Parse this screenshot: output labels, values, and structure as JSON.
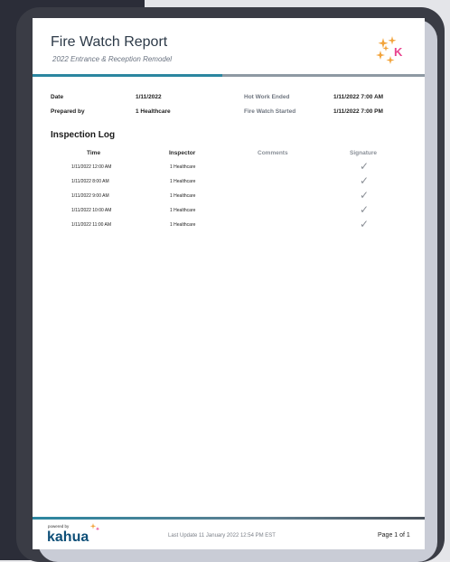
{
  "report": {
    "title": "Fire Watch Report",
    "subtitle": "2022 Entrance & Reception Remodel"
  },
  "info": {
    "date_label": "Date",
    "date_value": "1/11/2022",
    "prepared_label": "Prepared by",
    "prepared_value": "1 Healthcare",
    "hot_work_label": "Hot Work Ended",
    "hot_work_value": "1/11/2022 7:00 AM",
    "fire_watch_label": "Fire Watch Started",
    "fire_watch_value": "1/11/2022 7:00 PM"
  },
  "log": {
    "heading": "Inspection Log",
    "columns": {
      "time": "Time",
      "inspector": "Inspector",
      "comments": "Comments",
      "signature": "Signature"
    },
    "rows": [
      {
        "time": "1/11/2022 12:00 AM",
        "inspector": "1 Healthcare",
        "signature": "✓"
      },
      {
        "time": "1/11/2022 8:00 AM",
        "inspector": "1 Healthcare",
        "signature": "✓"
      },
      {
        "time": "1/11/2022 9:00 AM",
        "inspector": "1 Healthcare",
        "signature": "✓"
      },
      {
        "time": "1/11/2022 10:00 AM",
        "inspector": "1 Healthcare",
        "signature": "✓"
      },
      {
        "time": "1/11/2022 11:00 AM",
        "inspector": "1 Healthcare",
        "signature": "✓"
      }
    ]
  },
  "footer": {
    "powered_by": "powered by",
    "brand": "kahua",
    "last_update": "Last Update 11 January 2022 12:54 PM EST",
    "page": "Page 1 of 1"
  },
  "colors": {
    "accent_blue": "#2b86a0",
    "brand_blue": "#0e4f78",
    "logo_orange": "#f2a33a",
    "logo_pink": "#e8438f"
  },
  "icons": {
    "logo": "kahua-sparkle-logo",
    "signature": "checkmark-icon"
  }
}
